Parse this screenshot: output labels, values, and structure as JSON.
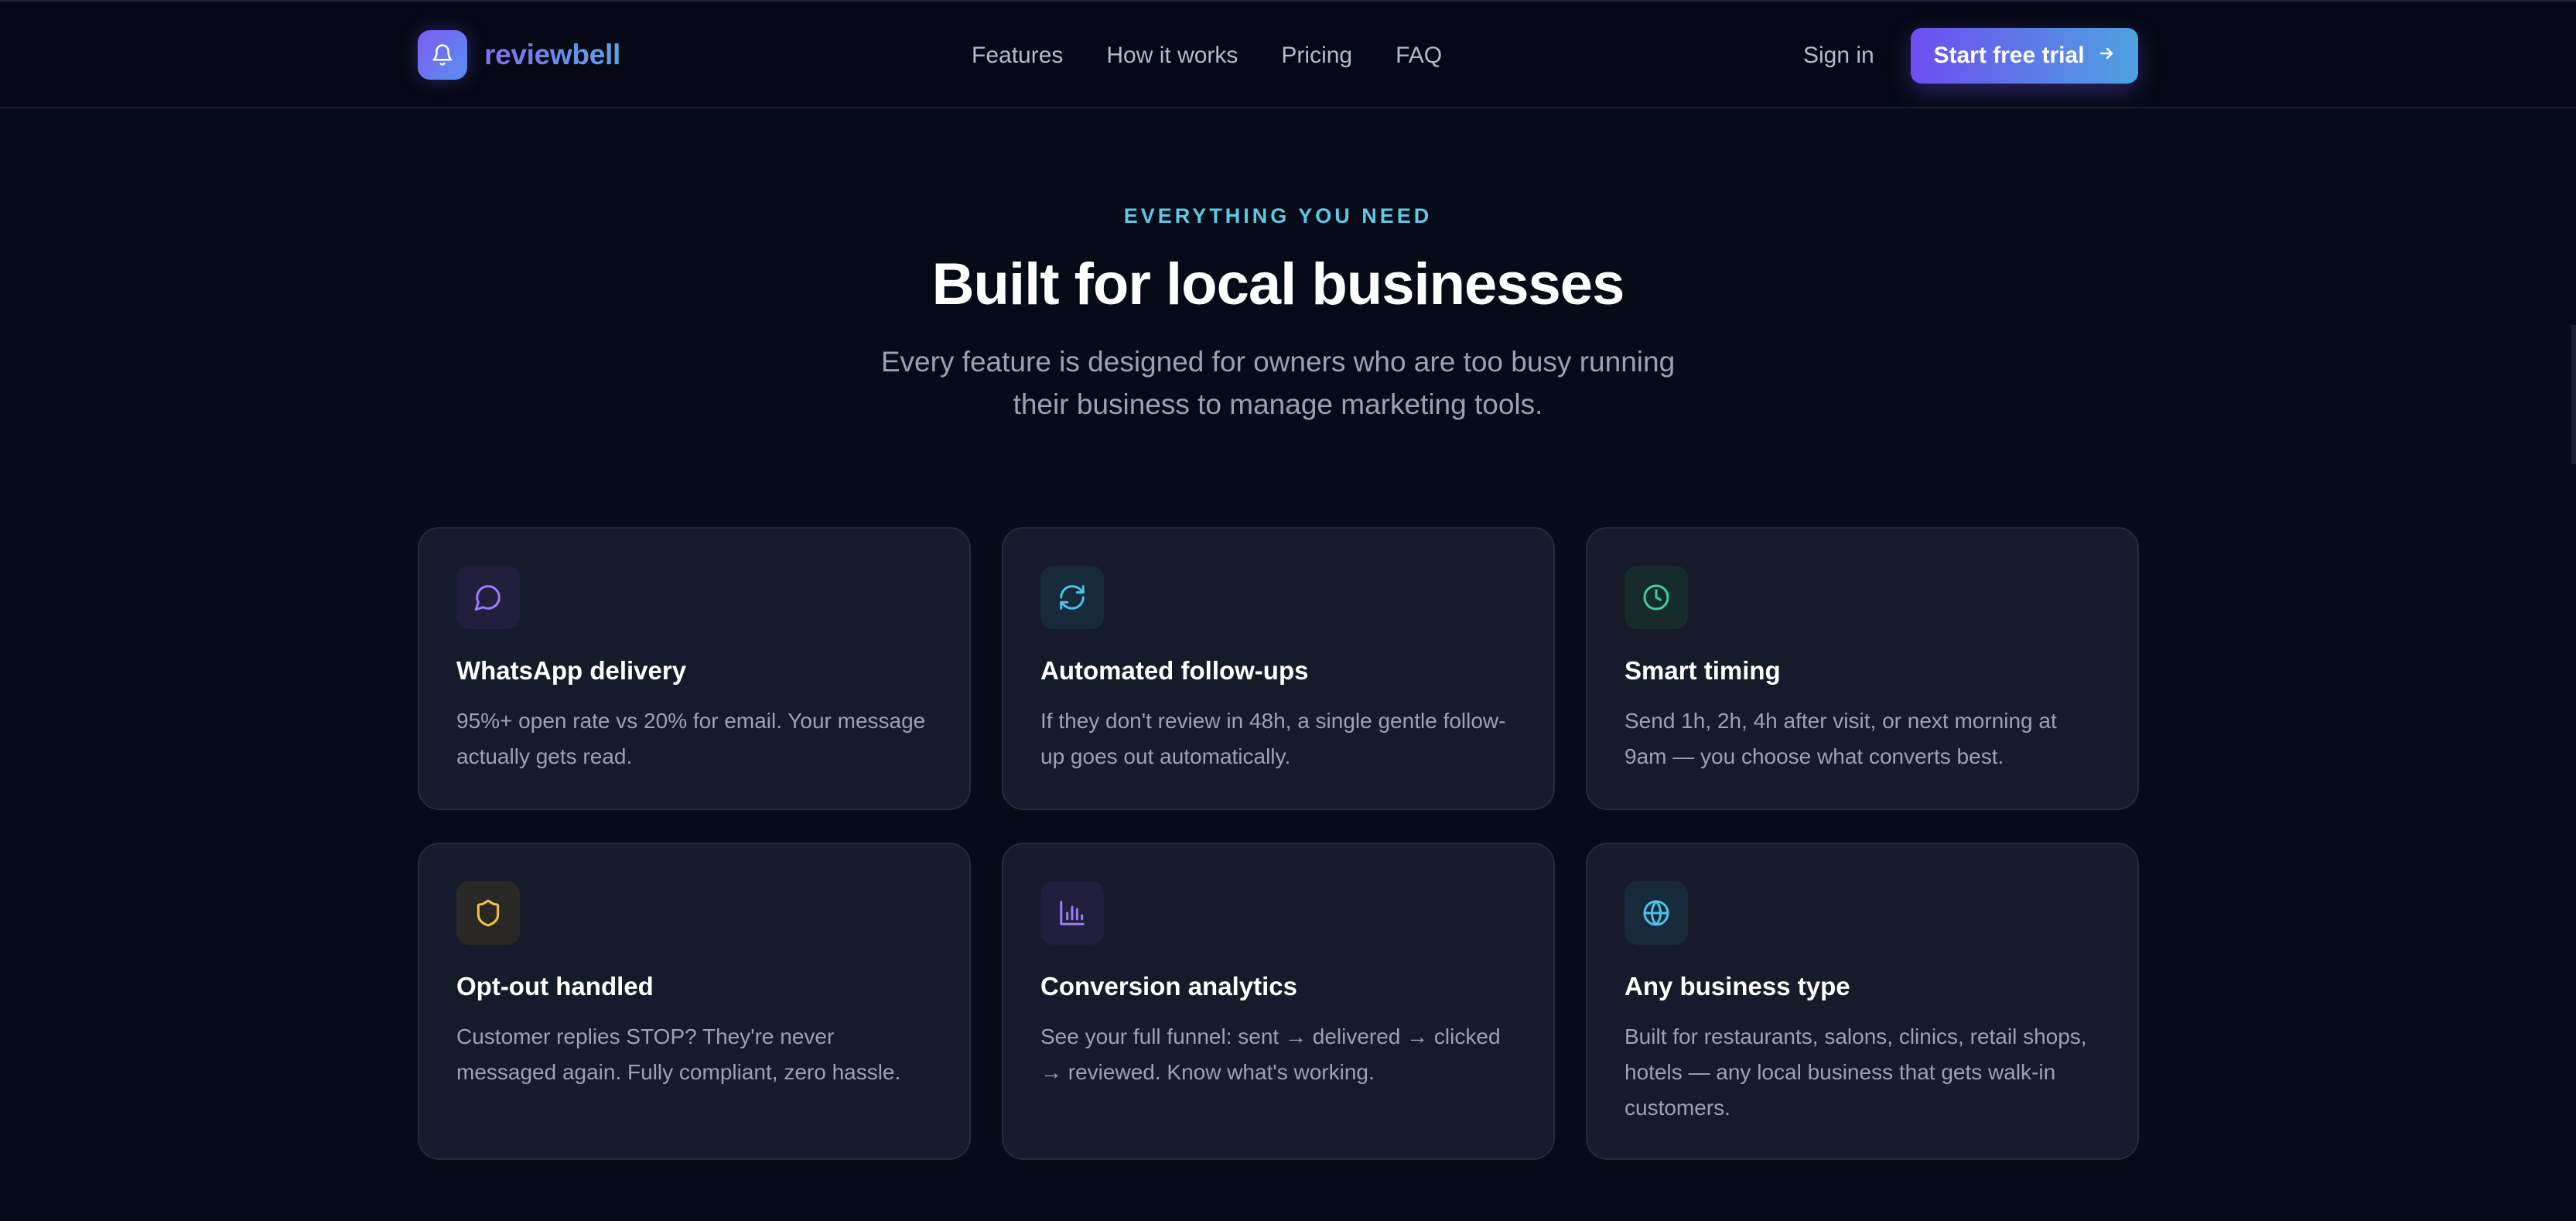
{
  "brand": {
    "name": "reviewbell",
    "logo_icon": "bell-icon"
  },
  "nav": {
    "links": [
      "Features",
      "How it works",
      "Pricing",
      "FAQ"
    ],
    "signin": "Sign in",
    "cta_label": "Start free trial",
    "cta_icon": "arrow-right-icon"
  },
  "hero": {
    "eyebrow": "EVERYTHING YOU NEED",
    "title": "Built for local businesses",
    "subtitle": "Every feature is designed for owners who are too busy running their business to manage marketing tools."
  },
  "features": [
    {
      "icon": "message-circle-icon",
      "title": "WhatsApp delivery",
      "description": "95%+ open rate vs 20% for email. Your message actually gets read."
    },
    {
      "icon": "refresh-icon",
      "title": "Automated follow-ups",
      "description": "If they don't review in 48h, a single gentle follow-up goes out automatically."
    },
    {
      "icon": "clock-icon",
      "title": "Smart timing",
      "description": "Send 1h, 2h, 4h after visit, or next morning at 9am — you choose what converts best."
    },
    {
      "icon": "shield-icon",
      "title": "Opt-out handled",
      "description": "Customer replies STOP? They're never messaged again. Fully compliant, zero hassle."
    },
    {
      "icon": "bar-chart-icon",
      "title": "Conversion analytics",
      "description": "See your full funnel: sent → delivered → clicked → reviewed. Know what's working."
    },
    {
      "icon": "globe-icon",
      "title": "Any business type",
      "description": "Built for restaurants, salons, clinics, retail shops, hotels — any local business that gets walk-in customers."
    }
  ],
  "colors": {
    "background": "#070b17",
    "card": "#151b2a",
    "accent_purple": "#6d4ef0",
    "accent_blue": "#4ea2e0",
    "eyebrow": "#5ec8e8"
  }
}
